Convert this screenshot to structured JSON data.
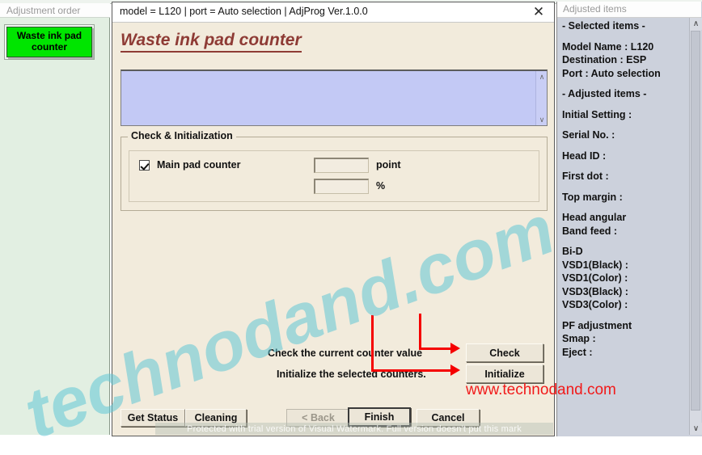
{
  "parent_window": {
    "ghost_label": ""
  },
  "left_panel": {
    "header": "Adjustment order",
    "items": [
      {
        "label": "Waste ink pad counter",
        "color": "#00e500",
        "selected": true
      }
    ]
  },
  "dialog": {
    "titlebar": "model = L120 | port = Auto selection | AdjProg Ver.1.0.0",
    "close_icon": "✕",
    "heading": "Waste ink pad counter",
    "log_box": {
      "value": "",
      "scroll_up_icon": "∧",
      "scroll_down_icon": "∨"
    },
    "group": {
      "legend": "Check & Initialization",
      "checkbox": {
        "label": "Main pad counter",
        "checked": true
      },
      "fields": [
        {
          "value": "",
          "unit": "point"
        },
        {
          "value": "",
          "unit": "%"
        }
      ]
    },
    "actions": [
      {
        "caption": "Check the current counter value",
        "button": "Check"
      },
      {
        "caption": "Initialize the selected counters.",
        "button": "Initialize"
      }
    ],
    "footer_buttons": [
      {
        "label": "Get Status",
        "state": "enabled",
        "default": false
      },
      {
        "label": "Cleaning",
        "state": "enabled",
        "default": false
      },
      {
        "label": "< Back",
        "state": "disabled",
        "default": false
      },
      {
        "label": "Finish",
        "state": "enabled",
        "default": true
      },
      {
        "label": "Cancel",
        "state": "enabled",
        "default": false
      }
    ]
  },
  "right_panel": {
    "header": "Adjusted items",
    "scroll_up_icon": "∧",
    "scroll_down_icon": "∨",
    "lines": [
      "- Selected items -",
      "",
      "Model Name : L120",
      "Destination : ESP",
      "Port : Auto selection",
      "",
      "- Adjusted items -",
      "",
      "Initial Setting :",
      "",
      "Serial No. :",
      "",
      "Head ID :",
      "",
      "First dot :",
      "",
      "Top margin :",
      "",
      "Head angular",
      " Band feed :",
      "",
      "Bi-D",
      " VSD1(Black) :",
      " VSD1(Color) :",
      " VSD3(Black) :",
      " VSD3(Color) :",
      "",
      "PF adjustment",
      " Smap :",
      "Eject :"
    ]
  },
  "watermarks": {
    "red_url": "www.technodand.com",
    "blue_text": "technodand.com",
    "bottom_notice": "Protected with trial version of Visual Watermark. Full version doesn't put this mark"
  }
}
